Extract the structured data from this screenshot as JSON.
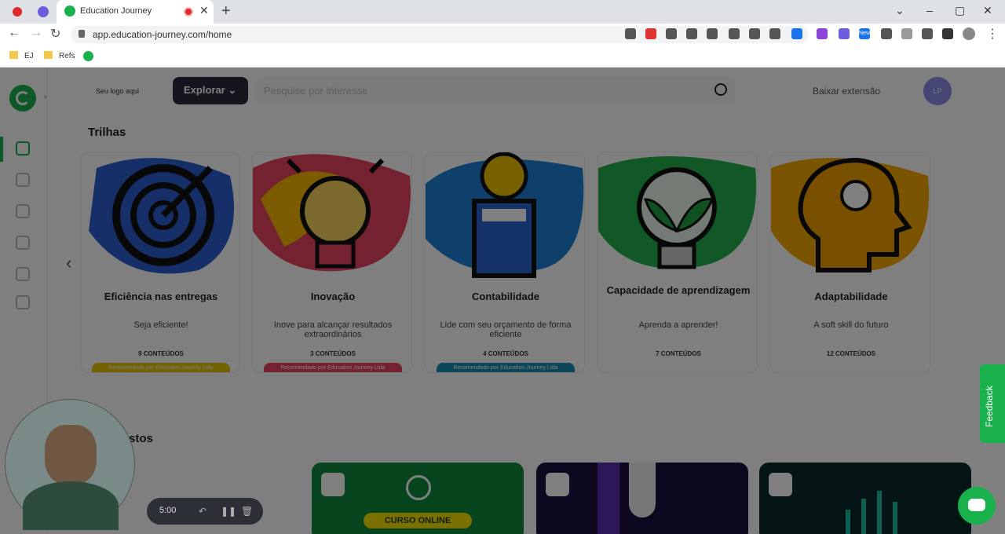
{
  "browser": {
    "tab_title": "Education Journey",
    "url": "app.education-journey.com/home",
    "bookmarks": [
      "EJ",
      "Refs"
    ],
    "new_badge": "New"
  },
  "header": {
    "logo_text": "Seu logo aqui",
    "explore_label": "Explorar",
    "search_placeholder": "Pesquise por interesse",
    "download_label": "Baixar extensão",
    "avatar_initials": "LP"
  },
  "sections": {
    "trails_title": "Trilhas",
    "second_title": "stos"
  },
  "trails": [
    {
      "title": "Eficiência nas entregas",
      "subtitle": "Seja eficiente!",
      "count": "9 CONTEÚDOS",
      "recommended": "Recomendado por Education Journey Ltda",
      "color": "#e6c400"
    },
    {
      "title": "Inovação",
      "subtitle": "Inove para alcançar resultados extraordinários",
      "count": "3 CONTEÚDOS",
      "recommended": "Recomendado por Education Journey Ltda",
      "color": "#e8455f"
    },
    {
      "title": "Contabilidade",
      "subtitle": "Lide com seu orçamento de forma eficiente",
      "count": "4 CONTEÚDOS",
      "recommended": "Recomendado por Education Journey Ltda",
      "color": "#178fb0"
    },
    {
      "title": "Capacidade de aprendizagem",
      "subtitle": "Aprenda a aprender!",
      "count": "7 CONTEÚDOS",
      "recommended": "",
      "color": ""
    },
    {
      "title": "Adaptabilidade",
      "subtitle": "A soft skill do futuro",
      "count": "12 CONTEÚDOS",
      "recommended": "",
      "color": ""
    }
  ],
  "recorder": {
    "time": "5:00"
  },
  "courses": {
    "online_label": "CURSO ONLINE"
  },
  "feedback_label": "Feedback"
}
